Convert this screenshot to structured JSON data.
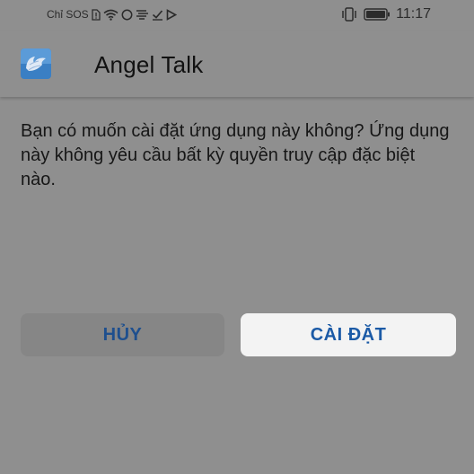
{
  "status_bar": {
    "carrier": "Chỉ SOS",
    "time": "11:17",
    "icons_left": [
      "sim-alert-icon",
      "wifi-icon",
      "circle-icon",
      "cast-icon",
      "check-icon",
      "play-icon"
    ],
    "icons_right": [
      "vibrate-icon",
      "battery-icon"
    ]
  },
  "header": {
    "title": "Angel Talk",
    "app_icon": "angel-wings-icon"
  },
  "dialog": {
    "message": "Bạn có muốn cài đặt ứng dụng này không? Ứng dụng này không yêu cầu bất kỳ quyền truy cập đặc biệt nào.",
    "cancel_label": "HỦY",
    "install_label": "CÀI ĐẶT"
  },
  "colors": {
    "background": "#8f8f8f",
    "button_text": "#1b5aa6",
    "install_button_bg": "#f3f3f3",
    "cancel_button_bg": "#868686"
  }
}
